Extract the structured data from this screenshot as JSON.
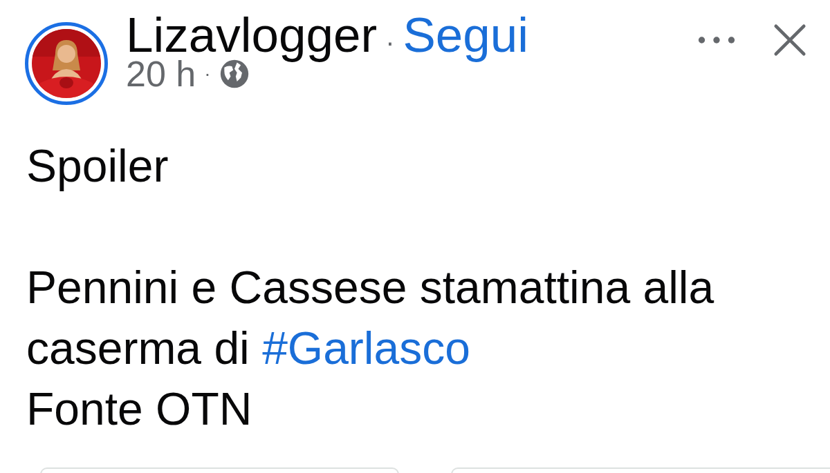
{
  "post": {
    "author": "Lizavlogger",
    "separator": "·",
    "follow_label": "Segui",
    "time": "20 h",
    "time_separator": "·",
    "audience_public": true,
    "avatar": {
      "kind": "picture",
      "story_ring": true
    },
    "paragraphs": [
      {
        "lines": [
          [
            {
              "kind": "text",
              "text": "Spoiler"
            }
          ]
        ]
      },
      {
        "lines": [
          [
            {
              "kind": "text",
              "text": "Pennini e Cassese stamattina alla caserma di "
            },
            {
              "kind": "hashtag",
              "text": "#Garlasco"
            }
          ],
          [
            {
              "kind": "text",
              "text": "Fonte OTN"
            }
          ]
        ]
      }
    ]
  },
  "actions": [
    {
      "kind": "pill"
    },
    {
      "kind": "pill"
    }
  ]
}
